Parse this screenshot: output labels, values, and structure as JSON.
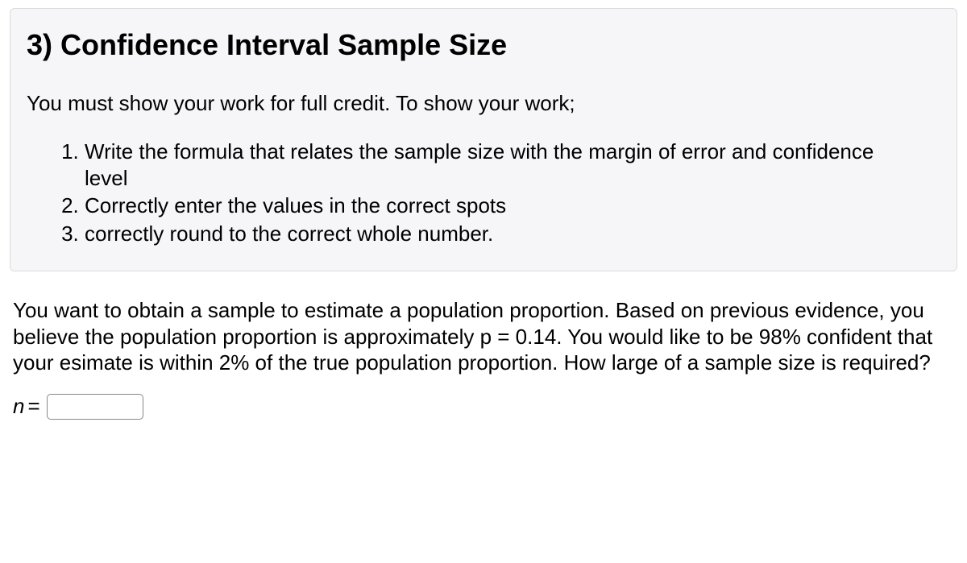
{
  "title": "3) Confidence Interval Sample Size",
  "intro": "You must show your work for full credit.  To show your work;",
  "steps": [
    "Write the formula that relates the sample size with the margin of error and confidence level",
    "Correctly enter the values in the correct spots",
    "correctly round to the correct whole number."
  ],
  "question": "You want to obtain a sample to estimate a population proportion. Based on previous evidence, you believe the population proportion is approximately p = 0.14. You would like to be 98% confident that your esimate is within 2% of the true population proportion. How large of a sample size is required?",
  "answer": {
    "label": "n",
    "eq": "=",
    "value": ""
  }
}
